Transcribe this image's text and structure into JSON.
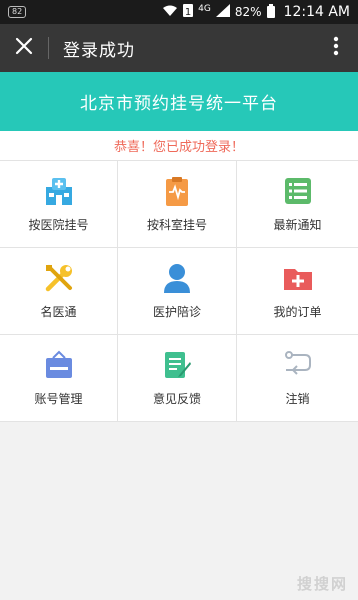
{
  "status_bar": {
    "notification_badge": "82",
    "network": "4G",
    "battery": "82%",
    "time": "12:14 AM"
  },
  "app_bar": {
    "title": "登录成功",
    "close_icon": "close-icon",
    "more_icon": "more-vertical-icon"
  },
  "banner": {
    "title": "北京市预约挂号统一平台"
  },
  "message": {
    "text": "恭喜！您已成功登录！"
  },
  "menu": {
    "items": [
      {
        "label": "按医院挂号",
        "icon": "hospital-icon",
        "color": "#36a9e1"
      },
      {
        "label": "按科室挂号",
        "icon": "clipboard-pulse-icon",
        "color": "#f59a45"
      },
      {
        "label": "最新通知",
        "icon": "list-icon",
        "color": "#5cba6a"
      },
      {
        "label": "名医通",
        "icon": "tools-icon",
        "color": "#f6c12a"
      },
      {
        "label": "医护陪诊",
        "icon": "person-icon",
        "color": "#3a8fd8"
      },
      {
        "label": "我的订单",
        "icon": "folder-plus-icon",
        "color": "#e95b5b"
      },
      {
        "label": "账号管理",
        "icon": "signboard-icon",
        "color": "#6a8be0"
      },
      {
        "label": "意见反馈",
        "icon": "edit-document-icon",
        "color": "#3fbf8f"
      },
      {
        "label": "注销",
        "icon": "logout-icon",
        "color": "#aab4c0"
      }
    ]
  },
  "watermark": "搜搜网"
}
